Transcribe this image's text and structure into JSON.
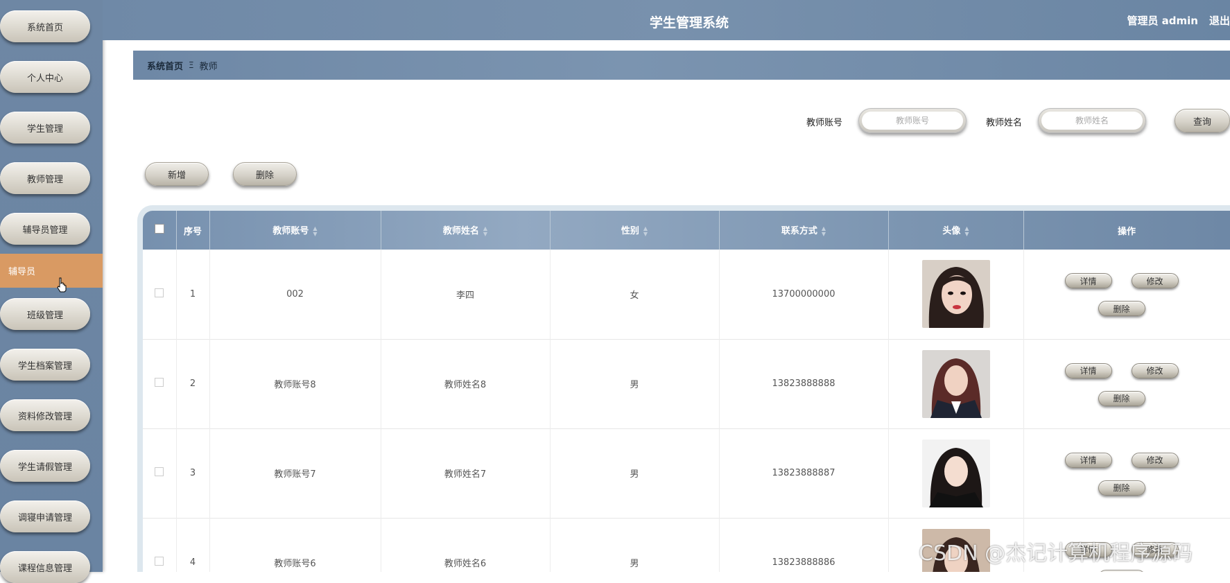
{
  "sidebar": {
    "items": [
      {
        "label": "系统首页"
      },
      {
        "label": "个人中心"
      },
      {
        "label": "学生管理"
      },
      {
        "label": "教师管理"
      },
      {
        "label": "辅导员管理"
      },
      {
        "label": "班级管理"
      },
      {
        "label": "学生档案管理"
      },
      {
        "label": "资料修改管理"
      },
      {
        "label": "学生请假管理"
      },
      {
        "label": "调寝申请管理"
      },
      {
        "label": "课程信息管理"
      }
    ],
    "active_sub": "辅导员"
  },
  "header": {
    "title": "学生管理系统",
    "user": "管理员 admin",
    "logout": "退出"
  },
  "breadcrumb": {
    "home": "系统首页",
    "separator": "Ξ",
    "current": "教师"
  },
  "search": {
    "account_label": "教师账号",
    "account_placeholder": "教师账号",
    "name_label": "教师姓名",
    "name_placeholder": "教师姓名",
    "query_button": "查询"
  },
  "toolbar": {
    "add_label": "新增",
    "delete_label": "删除"
  },
  "table": {
    "columns": [
      "序号",
      "教师账号",
      "教师姓名",
      "性别",
      "联系方式",
      "头像",
      "操作"
    ],
    "rows": [
      {
        "index": "1",
        "account": "002",
        "name": "李四",
        "gender": "女",
        "phone": "13700000000"
      },
      {
        "index": "2",
        "account": "教师账号8",
        "name": "教师姓名8",
        "gender": "男",
        "phone": "13823888888"
      },
      {
        "index": "3",
        "account": "教师账号7",
        "name": "教师姓名7",
        "gender": "男",
        "phone": "13823888887"
      },
      {
        "index": "4",
        "account": "教师账号6",
        "name": "教师姓名6",
        "gender": "男",
        "phone": "13823888886"
      }
    ],
    "row_actions": {
      "detail": "详情",
      "edit": "修改",
      "delete": "删除"
    }
  },
  "watermark": "CSDN @杰记计算机程序源码",
  "colors": {
    "sidebar_bg": "#6e87a4",
    "active_item": "#d99a63",
    "header_bg": "#7891ad"
  }
}
